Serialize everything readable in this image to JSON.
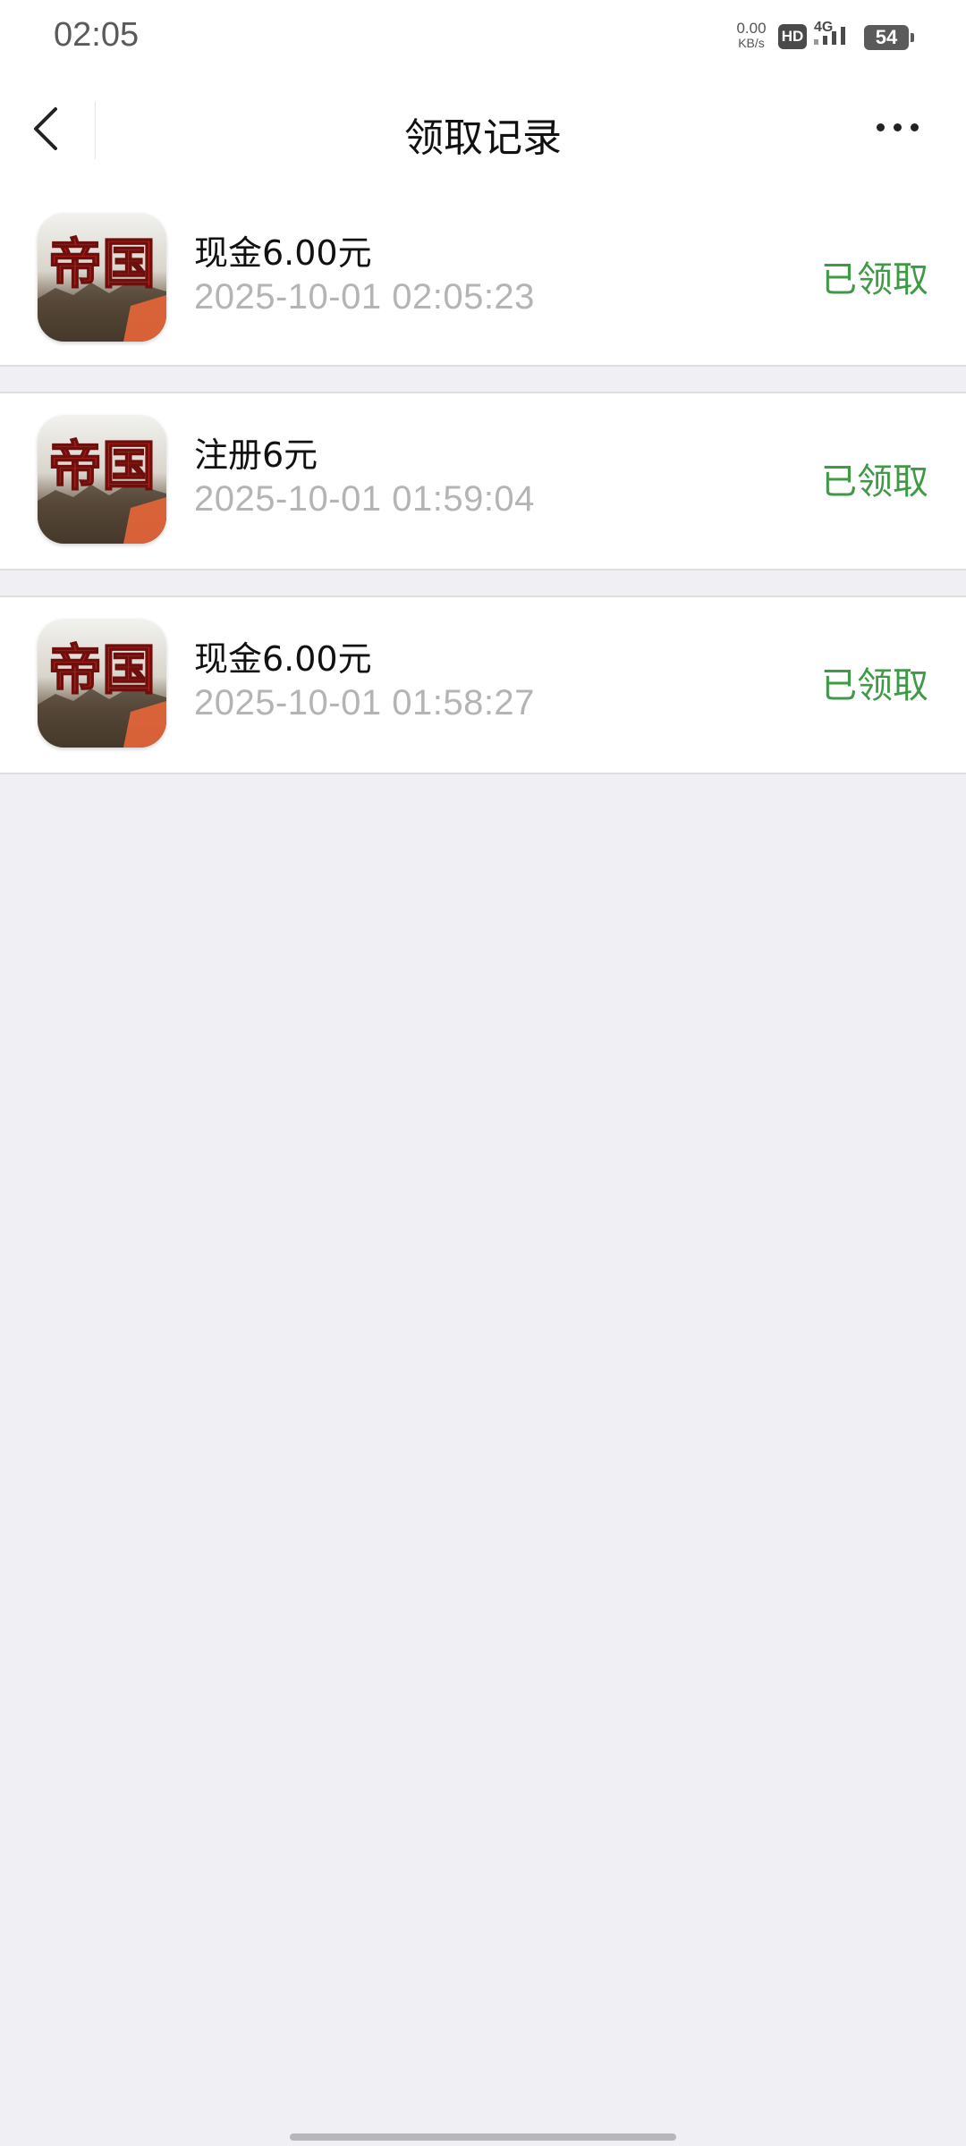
{
  "status_bar": {
    "time": "02:05",
    "net_speed_value": "0.00",
    "net_speed_unit": "KB/s",
    "hd": "HD",
    "network": "4G",
    "battery": "54"
  },
  "nav": {
    "title": "领取记录",
    "back_icon": "chevron-left-icon",
    "more_icon": "more-dots-icon"
  },
  "records": [
    {
      "icon_text": "帝国",
      "title": "现金6.00元",
      "time": "2025-10-01 02:05:23",
      "status": "已领取"
    },
    {
      "icon_text": "帝国",
      "title": "注册6元",
      "time": "2025-10-01 01:59:04",
      "status": "已领取"
    },
    {
      "icon_text": "帝国",
      "title": "现金6.00元",
      "time": "2025-10-01 01:58:27",
      "status": "已领取"
    }
  ],
  "colors": {
    "status_green": "#3f9a45",
    "background": "#efeff4",
    "icon_red": "#b3211d"
  }
}
